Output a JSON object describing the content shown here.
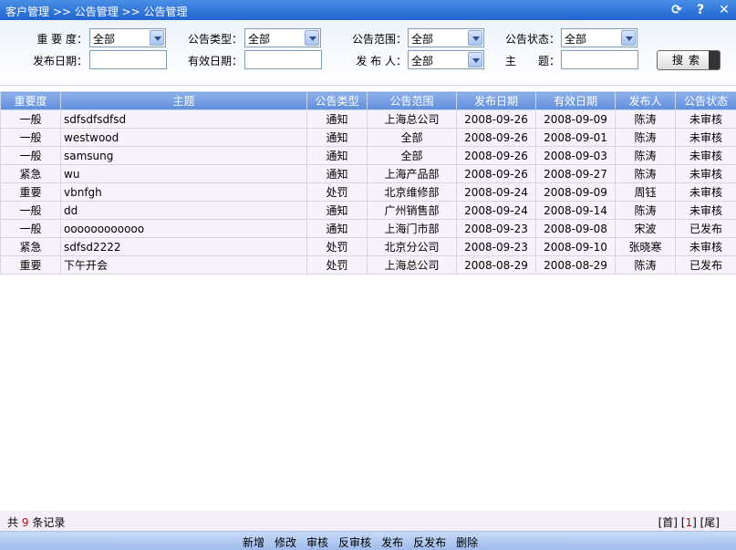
{
  "breadcrumb": "客户管理 >> 公告管理 >> 公告管理",
  "search": {
    "importance_label": "重 要 度：",
    "importance_value": "全部",
    "type_label": "公告类型：",
    "type_value": "全部",
    "scope_label": "公告范围：",
    "scope_value": "全部",
    "status_label": "公告状态：",
    "status_value": "全部",
    "publish_date_label": "发布日期：",
    "publish_date_value": "",
    "valid_date_label": "有效日期：",
    "valid_date_value": "",
    "publisher_label": "发 布 人：",
    "publisher_value": "全部",
    "subject_label": "主　　题：",
    "subject_value": "",
    "search_button": "搜索"
  },
  "table": {
    "headers": [
      "重要度",
      "主题",
      "公告类型",
      "公告范围",
      "发布日期",
      "有效日期",
      "发布人",
      "公告状态"
    ],
    "rows": [
      [
        "一般",
        "sdfsdfsdfsd",
        "通知",
        "上海总公司",
        "2008-09-26",
        "2008-09-09",
        "陈涛",
        "未审核"
      ],
      [
        "一般",
        "westwood",
        "通知",
        "全部",
        "2008-09-26",
        "2008-09-01",
        "陈涛",
        "未审核"
      ],
      [
        "一般",
        "samsung",
        "通知",
        "全部",
        "2008-09-26",
        "2008-09-03",
        "陈涛",
        "未审核"
      ],
      [
        "紧急",
        "wu",
        "通知",
        "上海产品部",
        "2008-09-26",
        "2008-09-27",
        "陈涛",
        "未审核"
      ],
      [
        "重要",
        "vbnfgh",
        "处罚",
        "北京维修部",
        "2008-09-24",
        "2008-09-09",
        "周钰",
        "未审核"
      ],
      [
        "一般",
        "dd",
        "通知",
        "广州销售部",
        "2008-09-24",
        "2008-09-14",
        "陈涛",
        "未审核"
      ],
      [
        "一般",
        "oooooooooooo",
        "通知",
        "上海门市部",
        "2008-09-23",
        "2008-09-08",
        "宋波",
        "已发布"
      ],
      [
        "紧急",
        "sdfsd2222",
        "处罚",
        "北京分公司",
        "2008-09-23",
        "2008-09-10",
        "张晓寒",
        "未审核"
      ],
      [
        "重要",
        "下午开会",
        "处罚",
        "上海总公司",
        "2008-08-29",
        "2008-08-29",
        "陈涛",
        "已发布"
      ]
    ]
  },
  "footer": {
    "count_prefix": "共",
    "count": "9",
    "count_suffix": "条记录",
    "pager_first": "[首]",
    "pager_current": "1",
    "pager_last": "[尾]"
  },
  "actions": [
    "新增",
    "修改",
    "审核",
    "反审核",
    "发布",
    "反发布",
    "删除"
  ]
}
